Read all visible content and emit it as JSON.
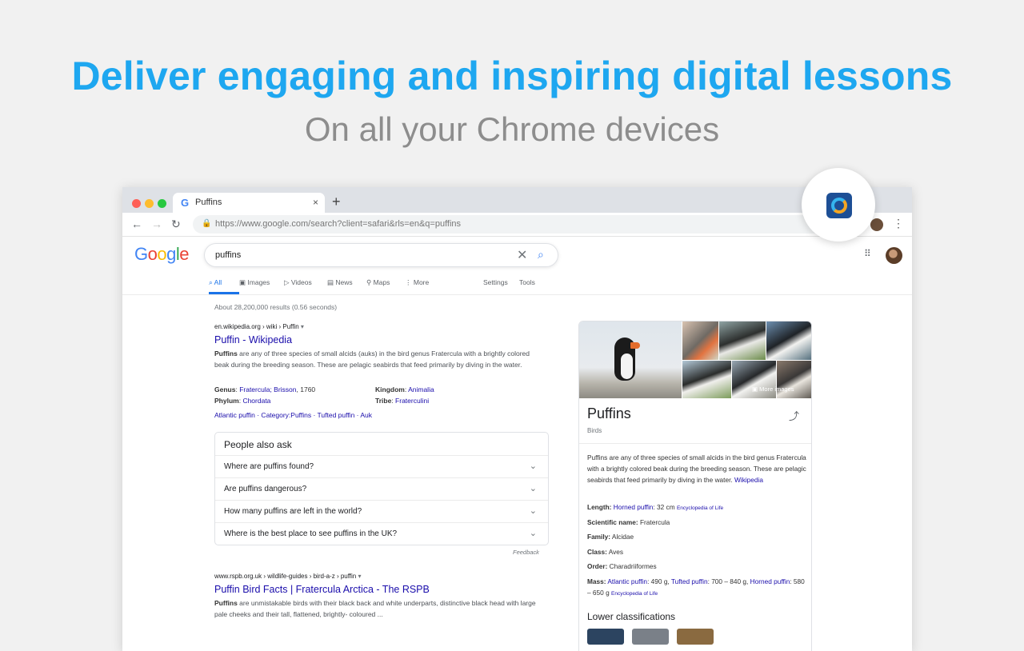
{
  "hero": {
    "title": "Deliver engaging and inspiring digital lessons",
    "subtitle": "On all your Chrome devices"
  },
  "browser": {
    "tab_title": "Puffins",
    "tab_close": "×",
    "new_tab": "+",
    "url": "https://www.google.com/search?client=safari&rls=en&q=puffins"
  },
  "google": {
    "logo": "Google",
    "query": "puffins",
    "tabs": [
      "All",
      "Images",
      "Videos",
      "News",
      "Maps",
      "More"
    ],
    "settings": "Settings",
    "tools": "Tools",
    "stats": "About 28,200,000 results (0.56 seconds)",
    "result1": {
      "cite": "en.wikipedia.org › wiki › Puffin",
      "title": "Puffin - Wikipedia",
      "snippet_bold": "Puffins",
      "snippet": " are any of three species of small alcids (auks) in the bird genus Fratercula with a brightly colored beak during the breeding season. These are pelagic seabirds that feed primarily by diving in the water.",
      "genus_label": "Genus",
      "genus_value": "Fratercula; Brisson",
      "genus_year": ", 1760",
      "phylum_label": "Phylum",
      "phylum_value": "Chordata",
      "kingdom_label": "Kingdom",
      "kingdom_value": "Animalia",
      "tribe_label": "Tribe",
      "tribe_value": "Fraterculini",
      "sitelinks": "Atlantic puffin · Category:Puffins · Tufted puffin · Auk"
    },
    "paa": {
      "title": "People also ask",
      "questions": [
        "Where are puffins found?",
        "Are puffins dangerous?",
        "How many puffins are left in the world?",
        "Where is the best place to see puffins in the UK?"
      ],
      "feedback": "Feedback"
    },
    "result2": {
      "cite": "www.rspb.org.uk › wildlife-guides › bird-a-z › puffin",
      "title": "Puffin Bird Facts | Fratercula Arctica - The RSPB",
      "snippet_bold": "Puffins",
      "snippet": " are unmistakable birds with their black back and white underparts, distinctive black head with large pale cheeks and their tall, flattened, brightly- coloured ..."
    },
    "knowledge_panel": {
      "more_images": "More images",
      "title": "Puffins",
      "type": "Birds",
      "description": "Puffins are any of three species of small alcids in the bird genus Fratercula with a brightly colored beak during the breeding season. These are pelagic seabirds that feed primarily by diving in the water.",
      "description_source": "Wikipedia",
      "length_label": "Length:",
      "length_link": "Horned puffin",
      "length_value": ": 32 cm",
      "length_src": "Encyclopedia of Life",
      "sci_label": "Scientific name:",
      "sci_value": "Fratercula",
      "family_label": "Family:",
      "family_value": "Alcidae",
      "class_label": "Class:",
      "class_value": "Aves",
      "order_label": "Order:",
      "order_value": "Charadriiformes",
      "mass_label": "Mass:",
      "mass_link1": "Atlantic puffin",
      "mass_v1": ": 490 g, ",
      "mass_link2": "Tufted puffin",
      "mass_v2": ": 700 – 840 g, ",
      "mass_link3": "Horned puffin",
      "mass_v3": ": 580 – 650 g",
      "mass_src": "Encyclopedia of Life",
      "lower": "Lower classifications"
    }
  },
  "colors": {
    "hero_title": "#1ea7f0",
    "hero_subtitle": "#8d8d8d",
    "link": "#1a0dab",
    "accent": "#1a73e8"
  }
}
